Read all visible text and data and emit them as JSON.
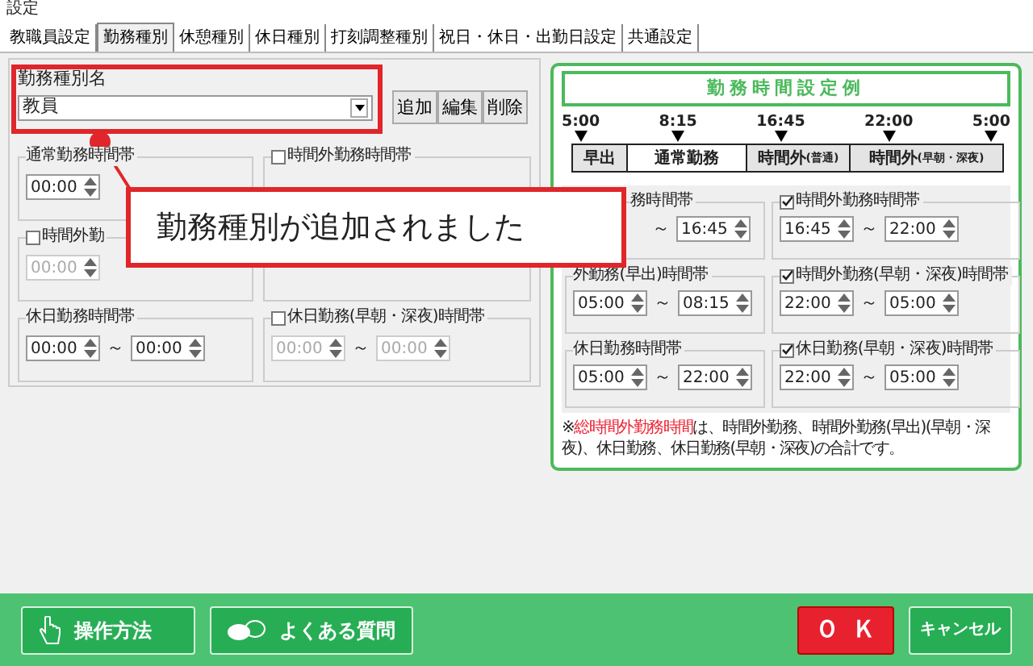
{
  "window": {
    "title": "設定"
  },
  "tabs": [
    {
      "label": "教職員設定",
      "selected": false
    },
    {
      "label": "勤務種別",
      "selected": true
    },
    {
      "label": "休憩種別",
      "selected": false
    },
    {
      "label": "休日種別",
      "selected": false
    },
    {
      "label": "打刻調整種別",
      "selected": false
    },
    {
      "label": "祝日・休日・出勤日設定",
      "selected": false
    },
    {
      "label": "共通設定",
      "selected": false
    }
  ],
  "type_name": {
    "label": "勤務種別名",
    "value": "教員"
  },
  "type_buttons": [
    "追加",
    "編集",
    "削除"
  ],
  "groups": [
    {
      "title": "通常勤務時間帯",
      "kind": "plain",
      "times": [
        "00:00"
      ]
    },
    {
      "title": "時間外勤務時間帯",
      "kind": "checkbox",
      "checked": false
    },
    {
      "title": "時間外勤",
      "kind": "checkbox",
      "checked": false,
      "times": [
        "00:00"
      ]
    },
    {
      "kind": "plain"
    },
    {
      "title": "休日勤務時間帯",
      "kind": "plain",
      "times": [
        "00:00",
        "00:00"
      ],
      "separator": "～"
    },
    {
      "title": "休日勤務(早朝・深夜)時間帯",
      "kind": "checkbox",
      "checked": false,
      "times": [
        "00:00",
        "00:00"
      ],
      "separator": "～"
    }
  ],
  "example": {
    "title": "勤務時間設定例",
    "marks": [
      "5:00",
      "8:15",
      "16:45",
      "22:00",
      "5:00"
    ],
    "segments": [
      {
        "label": "早出",
        "kind": "shaded"
      },
      {
        "label": "通常勤務",
        "kind": "plain"
      },
      {
        "label": "時間外",
        "note": "(普通)",
        "kind": "shaded"
      },
      {
        "label": "時間外",
        "note": "(早朝・深夜)",
        "kind": "shaded"
      }
    ],
    "groups": [
      {
        "title": "務時間帯",
        "kind": "plain",
        "times": [
          "16:45"
        ],
        "separator": "～"
      },
      {
        "title": "時間外勤務時間帯",
        "kind": "checkbox",
        "checked": true,
        "times": [
          "16:45",
          "22:00"
        ],
        "separator": "～"
      },
      {
        "title": "外勤務(早出)時間帯",
        "kind": "plain",
        "times": [
          "05:00",
          "08:15"
        ],
        "separator": "～"
      },
      {
        "title": "時間外勤務(早朝・深夜)時間帯",
        "kind": "checkbox",
        "checked": true,
        "times": [
          "22:00",
          "05:00"
        ],
        "separator": "～"
      },
      {
        "title": "休日勤務時間帯",
        "kind": "plain",
        "times": [
          "05:00",
          "22:00"
        ],
        "separator": "～"
      },
      {
        "title": "休日勤務(早朝・深夜)時間帯",
        "kind": "checkbox",
        "checked": true,
        "times": [
          "22:00",
          "05:00"
        ],
        "separator": "～"
      }
    ],
    "note": {
      "prefix": "※",
      "highlight": "総時間外勤務時間",
      "text": "は、時間外勤務、時間外勤務(早出)(早朝・深夜)、休日勤務、休日勤務(早朝・深夜)の合計です。"
    }
  },
  "callout": {
    "text": "勤務種別が追加されました"
  },
  "footer": {
    "help": "操作方法",
    "faq": "よくある質問",
    "ok": "ＯＫ",
    "cancel": "キャンセル"
  }
}
